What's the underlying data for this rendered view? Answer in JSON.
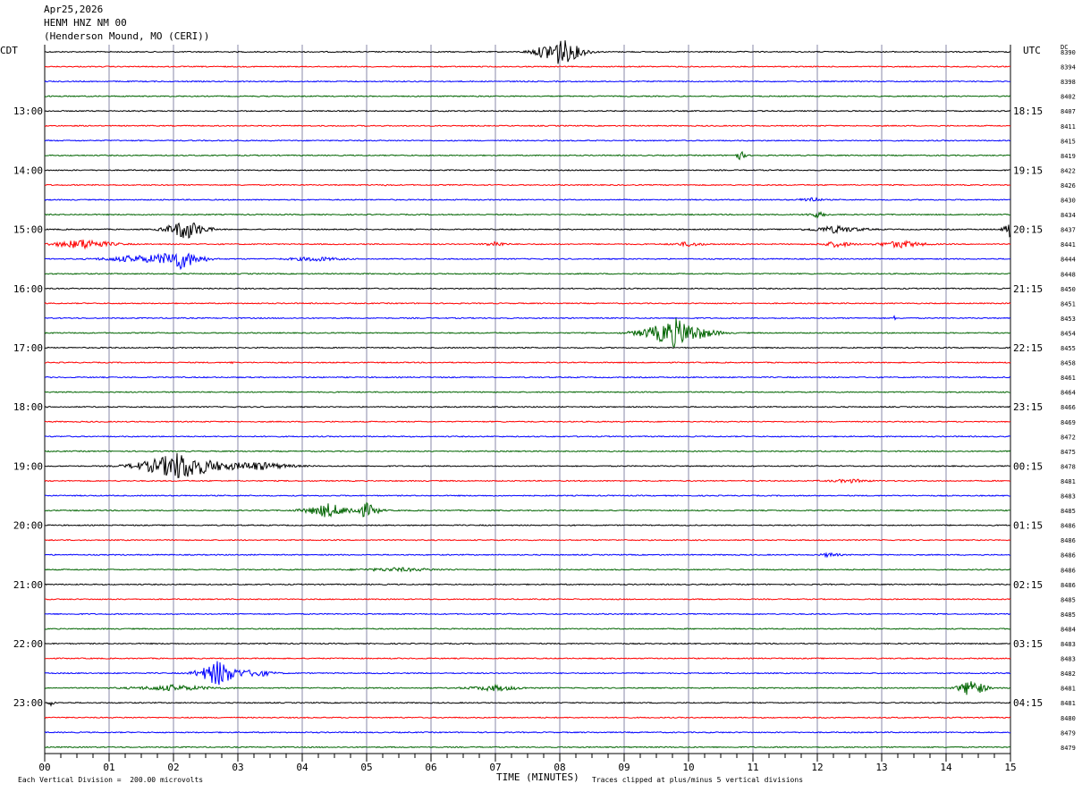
{
  "header": {
    "date": "Apr25,2026",
    "station": "HENM HNZ NM 00",
    "location": "(Henderson Mound, MO (CERI))"
  },
  "labels": {
    "left_tz": "CDT",
    "right_tz": "UTC",
    "dc": "DC",
    "x_title": "TIME (MINUTES)",
    "scale_note": "Each Vertical Division =  200.00 microvolts",
    "clip_note": "Traces clipped at plus/minus 5 vertical divisions"
  },
  "chart_data": {
    "type": "line",
    "title": "",
    "xlabel": "TIME (MINUTES)",
    "xlim": [
      0,
      15
    ],
    "x_ticks": [
      "00",
      "01",
      "02",
      "03",
      "04",
      "05",
      "06",
      "07",
      "08",
      "09",
      "10",
      "11",
      "12",
      "13",
      "14",
      "15"
    ],
    "trace_colors": [
      "#000000",
      "#ff0000",
      "#0000ff",
      "#006400"
    ],
    "left_hour_labels": [
      "13:00",
      "14:00",
      "15:00",
      "16:00",
      "17:00",
      "18:00",
      "19:00",
      "20:00",
      "21:00",
      "22:00",
      "23:00"
    ],
    "right_hour_labels": [
      "18:15",
      "19:15",
      "20:15",
      "21:15",
      "22:15",
      "23:15",
      "00:15",
      "01:15",
      "02:15",
      "03:15",
      "04:15"
    ],
    "dc_values": [
      "8390",
      "8394",
      "8398",
      "8402",
      "8407",
      "8411",
      "8415",
      "8419",
      "8422",
      "8426",
      "8430",
      "8434",
      "8437",
      "8441",
      "8444",
      "8448",
      "8450",
      "8451",
      "8453",
      "8454",
      "8455",
      "8458",
      "8461",
      "8464",
      "8466",
      "8469",
      "8472",
      "8475",
      "8478",
      "8481",
      "8483",
      "8485",
      "8486",
      "8486",
      "8486",
      "8486",
      "8486",
      "8485",
      "8485",
      "8484",
      "8483",
      "8483",
      "8482",
      "8481",
      "8481",
      "8480",
      "8479",
      "8479"
    ],
    "events": [
      {
        "trace": 0,
        "minute": 8.0,
        "amp": 1.0,
        "width": 0.7
      },
      {
        "trace": 7,
        "minute": 10.8,
        "amp": 0.35,
        "width": 0.15
      },
      {
        "trace": 9,
        "minute": 5.3,
        "amp": 0.25,
        "width": 0.03
      },
      {
        "trace": 10,
        "minute": 11.9,
        "amp": 0.2,
        "width": 0.3
      },
      {
        "trace": 11,
        "minute": 12.0,
        "amp": 0.2,
        "width": 0.3
      },
      {
        "trace": 12,
        "minute": 2.2,
        "amp": 0.75,
        "width": 0.6
      },
      {
        "trace": 12,
        "minute": 12.3,
        "amp": 0.25,
        "width": 0.8
      },
      {
        "trace": 12,
        "minute": 15.0,
        "amp": 0.7,
        "width": 0.2
      },
      {
        "trace": 13,
        "minute": 0.6,
        "amp": 0.35,
        "width": 0.9
      },
      {
        "trace": 13,
        "minute": 7.0,
        "amp": 0.2,
        "width": 0.3
      },
      {
        "trace": 13,
        "minute": 10.0,
        "amp": 0.15,
        "width": 0.5
      },
      {
        "trace": 13,
        "minute": 12.3,
        "amp": 0.2,
        "width": 0.5
      },
      {
        "trace": 13,
        "minute": 13.3,
        "amp": 0.25,
        "width": 0.7
      },
      {
        "trace": 14,
        "minute": 2.1,
        "amp": 0.7,
        "width": 0.7
      },
      {
        "trace": 14,
        "minute": 1.4,
        "amp": 0.25,
        "width": 1.0
      },
      {
        "trace": 14,
        "minute": 4.2,
        "amp": 0.15,
        "width": 0.8
      },
      {
        "trace": 18,
        "minute": 13.2,
        "amp": 0.15,
        "width": 0.05
      },
      {
        "trace": 19,
        "minute": 9.8,
        "amp": 1.0,
        "width": 1.0
      },
      {
        "trace": 21,
        "minute": 2.9,
        "amp": 0.15,
        "width": 0.05
      },
      {
        "trace": 28,
        "minute": 2.1,
        "amp": 1.0,
        "width": 1.2
      },
      {
        "trace": 28,
        "minute": 3.3,
        "amp": 0.3,
        "width": 1.0
      },
      {
        "trace": 29,
        "minute": 12.5,
        "amp": 0.12,
        "width": 0.6
      },
      {
        "trace": 31,
        "minute": 4.4,
        "amp": 0.5,
        "width": 0.7
      },
      {
        "trace": 31,
        "minute": 5.0,
        "amp": 0.5,
        "width": 0.4
      },
      {
        "trace": 34,
        "minute": 12.2,
        "amp": 0.15,
        "width": 0.3
      },
      {
        "trace": 35,
        "minute": 5.5,
        "amp": 0.12,
        "width": 1.2
      },
      {
        "trace": 42,
        "minute": 2.7,
        "amp": 0.95,
        "width": 0.6
      },
      {
        "trace": 42,
        "minute": 3.3,
        "amp": 0.25,
        "width": 0.5
      },
      {
        "trace": 43,
        "minute": 2.0,
        "amp": 0.2,
        "width": 1.2
      },
      {
        "trace": 43,
        "minute": 7.0,
        "amp": 0.2,
        "width": 0.8
      },
      {
        "trace": 43,
        "minute": 14.4,
        "amp": 0.7,
        "width": 0.4
      },
      {
        "trace": 44,
        "minute": 0.1,
        "amp": 0.2,
        "width": 0.1
      }
    ]
  }
}
